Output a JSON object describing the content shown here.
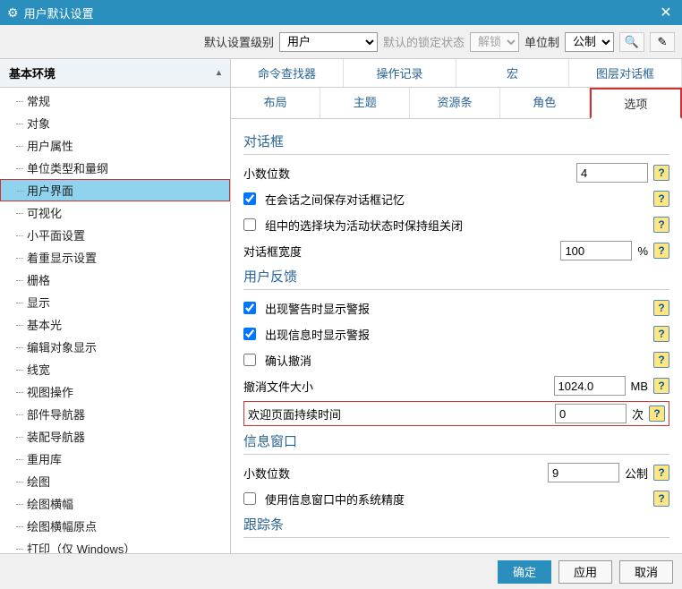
{
  "window": {
    "title": "用户默认设置"
  },
  "toolbar": {
    "level_label": "默认设置级别",
    "level_value": "用户",
    "lock_label": "默认的锁定状态",
    "lock_value": "解锁",
    "unit_label": "单位制",
    "unit_value": "公制"
  },
  "sidebar": {
    "header": "基本环境",
    "items": [
      "常规",
      "对象",
      "用户属性",
      "单位类型和量纲",
      "用户界面",
      "可视化",
      "小平面设置",
      "着重显示设置",
      "栅格",
      "显示",
      "基本光",
      "编辑对象显示",
      "线宽",
      "视图操作",
      "部件导航器",
      "装配导航器",
      "重用库",
      "绘图",
      "绘图横幅",
      "绘图横幅原点",
      "打印（仅 Windows）"
    ],
    "selected": 4
  },
  "tabs": {
    "row1": [
      "命令查找器",
      "操作记录",
      "宏",
      "图层对话框"
    ],
    "row2": [
      "布局",
      "主题",
      "资源条",
      "角色",
      "选项"
    ],
    "active": "选项"
  },
  "panel": {
    "dialog": {
      "title": "对话框",
      "decimals_label": "小数位数",
      "decimals_value": "4",
      "remember_label": "在会话之间保存对话框记忆",
      "remember_checked": true,
      "group_label": "组中的选择块为活动状态时保持组关闭",
      "group_checked": false,
      "width_label": "对话框宽度",
      "width_value": "100",
      "width_unit": "%"
    },
    "feedback": {
      "title": "用户反馈",
      "warn_label": "出现警告时显示警报",
      "warn_checked": true,
      "info_label": "出现信息时显示警报",
      "info_checked": true,
      "confirm_label": "确认撤消",
      "confirm_checked": false,
      "undo_size_label": "撤消文件大小",
      "undo_size_value": "1024.0",
      "undo_size_unit": "MB",
      "welcome_label": "欢迎页面持续时间",
      "welcome_value": "0",
      "welcome_unit": "次"
    },
    "infowin": {
      "title": "信息窗口",
      "decimals_label": "小数位数",
      "decimals_value": "9",
      "decimals_unit": "公制",
      "sys_label": "使用信息窗口中的系统精度",
      "sys_checked": false
    },
    "trackbar": {
      "title": "跟踪条"
    }
  },
  "footer": {
    "ok": "确定",
    "apply": "应用",
    "cancel": "取消"
  }
}
